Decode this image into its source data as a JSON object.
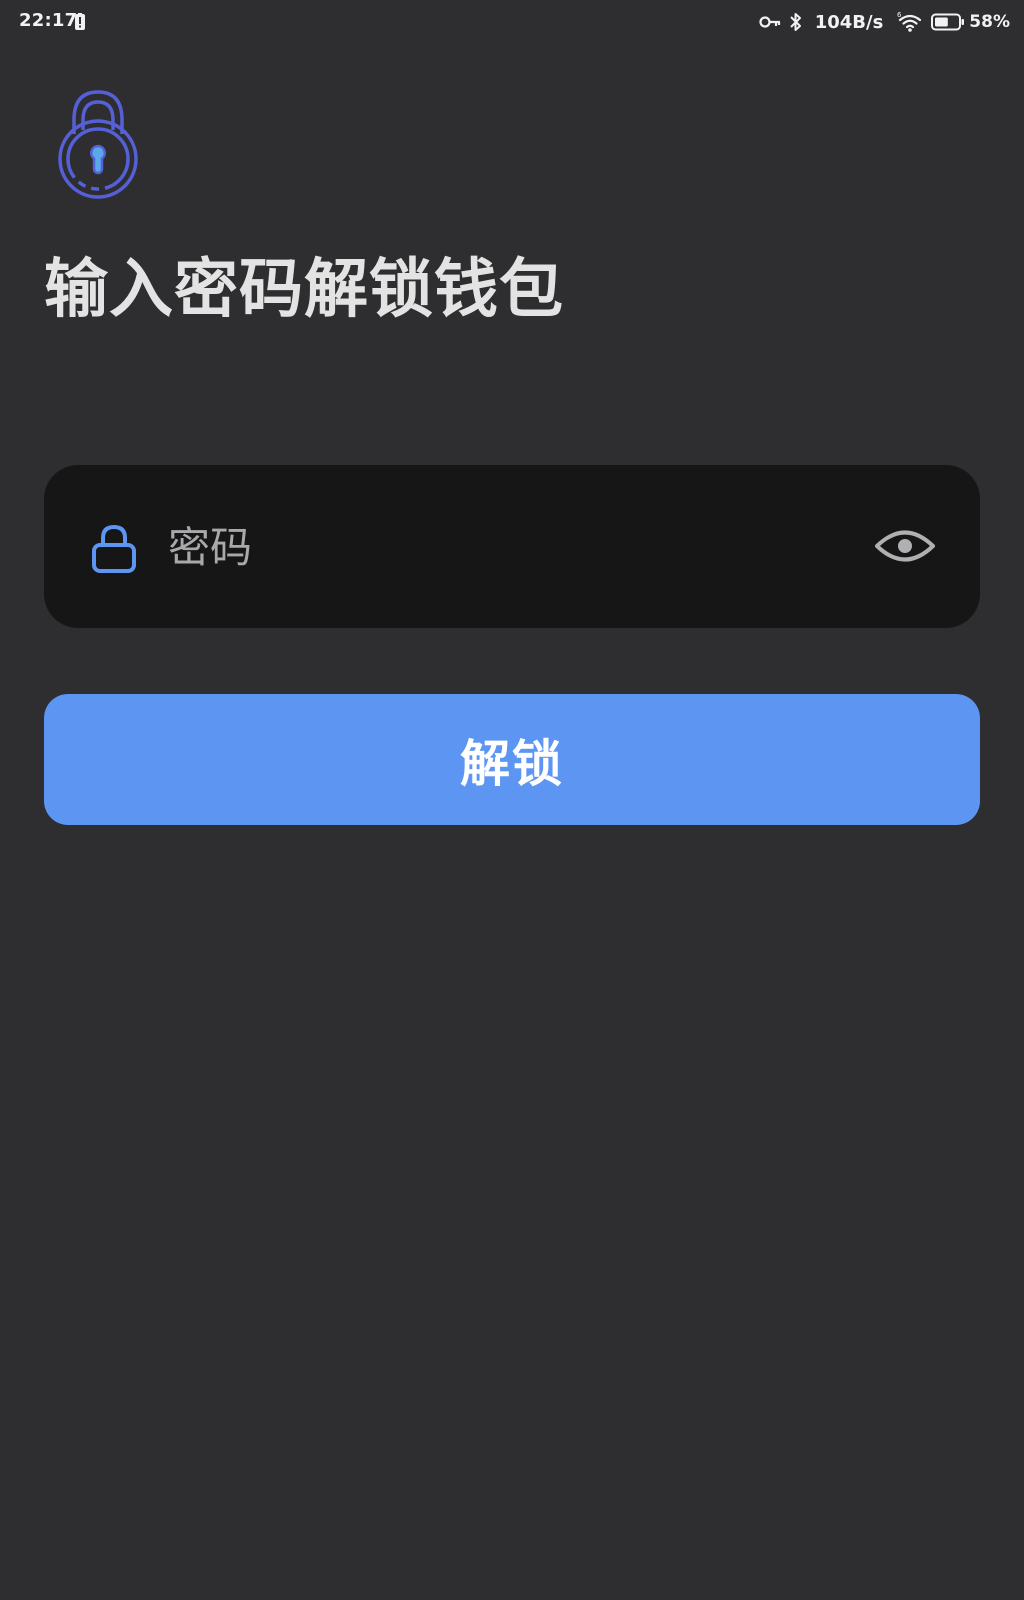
{
  "status_bar": {
    "time": "22:17",
    "net_speed": "104B/s",
    "battery_percent": "58%",
    "battery_level": 0.58,
    "icons": [
      "battery-alert-icon",
      "vpn-key-icon",
      "bluetooth-icon",
      "wifi-icon",
      "battery-icon"
    ]
  },
  "header": {
    "logo_icon": "padlock-icon",
    "title": "输入密码解锁钱包"
  },
  "password_field": {
    "icon": "lock-icon",
    "placeholder": "密码",
    "value": "",
    "toggle_icon": "eye-icon"
  },
  "actions": {
    "unlock_label": "解锁"
  },
  "colors": {
    "background": "#2e2e31",
    "field_background": "#161617",
    "accent": "#5c95f2",
    "logo": "#5560d6",
    "title_text": "#e3e3e3",
    "placeholder_text": "#a9a9ab"
  }
}
